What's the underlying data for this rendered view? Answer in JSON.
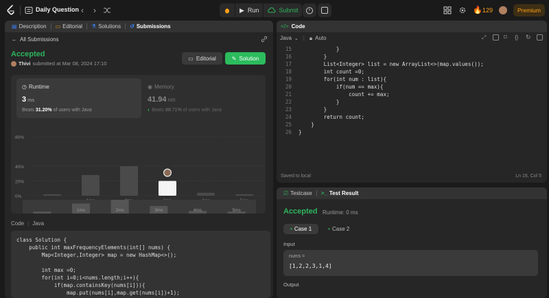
{
  "topbar": {
    "problem_list_label": "Daily Question",
    "run_label": "Run",
    "submit_label": "Submit",
    "streak": "129",
    "premium_label": "Premium"
  },
  "left_panel": {
    "tabs": [
      "Description",
      "Editorial",
      "Solutions",
      "Submissions"
    ],
    "back_label": "All Submissions",
    "status": "Accepted",
    "user": "Thivi",
    "submitted_text": "submitted at Mar 08, 2024 17:10",
    "editorial_button": "Editorial",
    "solution_button": "Solution",
    "runtime": {
      "label": "Runtime",
      "value": "3",
      "unit": "ms",
      "beats_prefix": "Beats",
      "beats_pct": "31.20%",
      "beats_suffix": "of users with Java"
    },
    "memory": {
      "label": "Memory",
      "value": "41.94",
      "unit": "MB",
      "beats_prefix": "Beats",
      "beats_pct": "88.71%",
      "beats_suffix": "of users with Java"
    },
    "code_label": "Code",
    "code_lang": "Java",
    "code_lines": [
      "class Solution {",
      "    public int maxFrequencyElements(int[] nums) {",
      "        Map<Integer,Integer> map = new HashMap<>();",
      "",
      "        int max =0;",
      "        for(int i=0;i<nums.length;i++){",
      "            if(map.containsKey(nums[i])){",
      "                map.put(nums[i],map.get(nums[i])+1);"
    ]
  },
  "chart_data": {
    "type": "bar",
    "y_ticks": [
      "80%",
      "40%",
      "20%",
      "0%"
    ],
    "categories": [
      "",
      "1ms",
      "2ms",
      "3ms",
      "4ms",
      "5ms"
    ],
    "values": [
      2,
      28,
      40,
      20,
      4,
      2
    ],
    "highlight_index": 3,
    "ylim": [
      0,
      80
    ],
    "minimap_labels": [
      "1ms",
      "2ms",
      "3ms",
      "4ms",
      "5ms"
    ],
    "accent": "#f5f5f5",
    "bar_color": "#4a4a4a"
  },
  "editor": {
    "title": "Code",
    "language": "Java",
    "mode": "Auto",
    "lines": [
      {
        "n": "15",
        "t": "            }"
      },
      {
        "n": "16",
        "t": "        }"
      },
      {
        "n": "17",
        "t": "        List<Integer> list = new ArrayList<>(map.values());"
      },
      {
        "n": "18",
        "t": "        int count =0;"
      },
      {
        "n": "19",
        "t": "        for(int num : list){"
      },
      {
        "n": "20",
        "t": "            if(num == max){"
      },
      {
        "n": "21",
        "t": "                count += max;"
      },
      {
        "n": "22",
        "t": "            }"
      },
      {
        "n": "23",
        "t": "        }"
      },
      {
        "n": "24",
        "t": "        return count;"
      },
      {
        "n": "25",
        "t": "    }"
      },
      {
        "n": "26",
        "t": "}"
      }
    ],
    "status": "Saved to local",
    "position": "Ln 16, Col 5"
  },
  "result_panel": {
    "tabs": [
      "Testcase",
      "Test Result"
    ],
    "status": "Accepted",
    "runtime": "Runtime: 0 ms",
    "cases": [
      "Case 1",
      "Case 2"
    ],
    "input_label": "Input",
    "input_name": "nums =",
    "input_value": "[1,2,2,3,1,4]",
    "output_label": "Output"
  }
}
